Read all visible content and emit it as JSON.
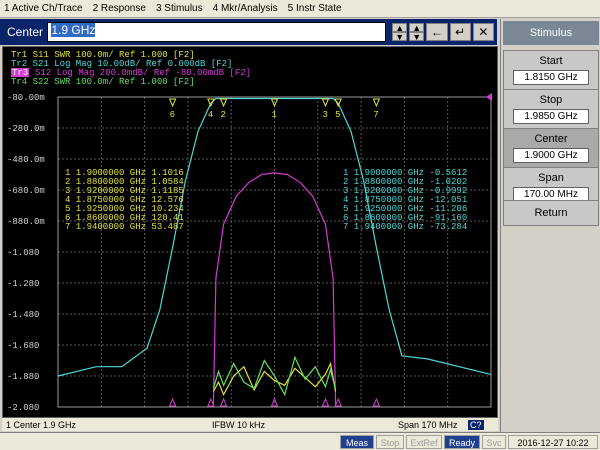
{
  "menu": [
    "1 Active Ch/Trace",
    "2 Response",
    "3 Stimulus",
    "4 Mkr/Analysis",
    "5 Instr State"
  ],
  "entry": {
    "label": "Center",
    "value": "1.9 GHz",
    "btn_up": "▲",
    "btn_down": "▼",
    "btn_enter": "↵",
    "btn_back": "←",
    "btn_close": "✕"
  },
  "traces": {
    "tr1": "Tr1  S11  SWR 100.0m/ Ref 1.000  [F2]",
    "tr2": "Tr2  S21  Log Mag 10.00dB/ Ref 0.000dB  [F2]",
    "tr3_id": "Tr3",
    "tr3": "S12  Log Mag 200.0mdB/ Ref -80.00mdB  [F2]",
    "tr4": "Tr4  S22  SWR 100.0m/ Ref 1.000  [F2]"
  },
  "yticks": [
    "-80.00m",
    "-280.0m",
    "-480.0m",
    "-680.0m",
    "-880.0m",
    "-1.080",
    "-1.280",
    "-1.480",
    "-1.680",
    "-1.880",
    "-2.080"
  ],
  "markers_left": [
    [
      "1",
      "1.9000000 GHz",
      "1.1016"
    ],
    [
      "2",
      "1.8800000 GHz",
      "1.0584"
    ],
    [
      "3",
      "1.9200000 GHz",
      "1.1185"
    ],
    [
      "4",
      "1.8750000 GHz",
      "12.576"
    ],
    [
      "5",
      "1.9250000 GHz",
      "10.234"
    ],
    [
      "6",
      "1.8600000 GHz",
      "120.41"
    ],
    [
      "7",
      "1.9400000 GHz",
      "53.487"
    ]
  ],
  "markers_right": [
    [
      "1",
      "1.9000000 GHz",
      "-0.5612"
    ],
    [
      "2",
      "1.8800000 GHz",
      "-1.0202"
    ],
    [
      "3",
      "1.9200000 GHz",
      "-0.9992"
    ],
    [
      "4",
      "1.8750000 GHz",
      "-12.051"
    ],
    [
      "5",
      "1.9250000 GHz",
      "-11.206"
    ],
    [
      "6",
      "1.8600000 GHz",
      "-91.160"
    ],
    [
      "7",
      "1.9400000 GHz",
      "-73.284"
    ]
  ],
  "chart_data": {
    "type": "line",
    "x_unit": "GHz",
    "x_start": 1.815,
    "x_stop": 1.985,
    "ylim": [
      -2.08,
      -0.08
    ],
    "series": [
      {
        "name": "S21",
        "color": "#4fd6d6",
        "x": [
          1.815,
          1.83,
          1.84,
          1.85,
          1.855,
          1.86,
          1.865,
          1.87,
          1.875,
          1.877,
          1.88,
          1.9,
          1.92,
          1.923,
          1.925,
          1.93,
          1.935,
          1.94,
          1.945,
          1.95,
          1.96,
          1.985
        ],
        "y": [
          -1.88,
          -1.82,
          -1.82,
          -1.7,
          -1.45,
          -1.05,
          -0.62,
          -0.3,
          -0.12,
          -0.09,
          -0.09,
          -0.09,
          -0.09,
          -0.09,
          -0.12,
          -0.3,
          -0.62,
          -1.05,
          -1.45,
          -1.75,
          -1.77,
          -1.87
        ]
      },
      {
        "name": "S12",
        "color": "#d23cd2",
        "x": [
          1.876,
          1.877,
          1.88,
          1.885,
          1.89,
          1.895,
          1.9,
          1.905,
          1.91,
          1.915,
          1.92,
          1.923,
          1.924
        ],
        "y": [
          -2.07,
          -1.25,
          -0.9,
          -0.72,
          -0.63,
          -0.58,
          -0.57,
          -0.58,
          -0.63,
          -0.72,
          -0.9,
          -1.25,
          -2.07
        ]
      },
      {
        "name": "S11",
        "color": "#e0e040",
        "x": [
          1.876,
          1.878,
          1.88,
          1.884,
          1.888,
          1.892,
          1.896,
          1.9,
          1.904,
          1.908,
          1.912,
          1.916,
          1.92,
          1.922,
          1.924
        ],
        "y": [
          -1.98,
          -1.92,
          -2.0,
          -1.88,
          -1.82,
          -1.97,
          -1.85,
          -1.91,
          -1.94,
          -1.83,
          -1.89,
          -1.95,
          -1.87,
          -1.8,
          -1.98
        ]
      },
      {
        "name": "S22",
        "color": "#60e060",
        "x": [
          1.876,
          1.878,
          1.88,
          1.884,
          1.888,
          1.892,
          1.896,
          1.9,
          1.904,
          1.908,
          1.912,
          1.916,
          1.92,
          1.922,
          1.924
        ],
        "y": [
          -1.96,
          -1.85,
          -1.94,
          -1.8,
          -1.92,
          -1.96,
          -1.78,
          -1.88,
          -2.0,
          -1.76,
          -1.9,
          -1.82,
          -1.95,
          -1.84,
          -1.97
        ]
      }
    ],
    "markers": [
      {
        "id": "1",
        "x": 1.9
      },
      {
        "id": "2",
        "x": 1.88
      },
      {
        "id": "3",
        "x": 1.92
      },
      {
        "id": "4",
        "x": 1.875
      },
      {
        "id": "5",
        "x": 1.925
      },
      {
        "id": "6",
        "x": 1.86
      },
      {
        "id": "7",
        "x": 1.94
      }
    ]
  },
  "status": {
    "left": "1  Center 1.9 GHz",
    "mid": "IFBW 10 kHz",
    "right": "Span 170 MHz",
    "ch": "C?"
  },
  "instr": {
    "meas": "Meas",
    "stop": "Stop",
    "extref": "ExtRef",
    "ready": "Ready",
    "svc": "Svc",
    "date": "2016-12-27 10:22"
  },
  "softkeys": {
    "title": "Stimulus",
    "start_label": "Start",
    "start_value": "1.8150 GHz",
    "stop_label": "Stop",
    "stop_value": "1.9850 GHz",
    "center_label": "Center",
    "center_value": "1.9000 GHz",
    "span_label": "Span",
    "span_value": "170.00 MHz",
    "return_label": "Return"
  }
}
